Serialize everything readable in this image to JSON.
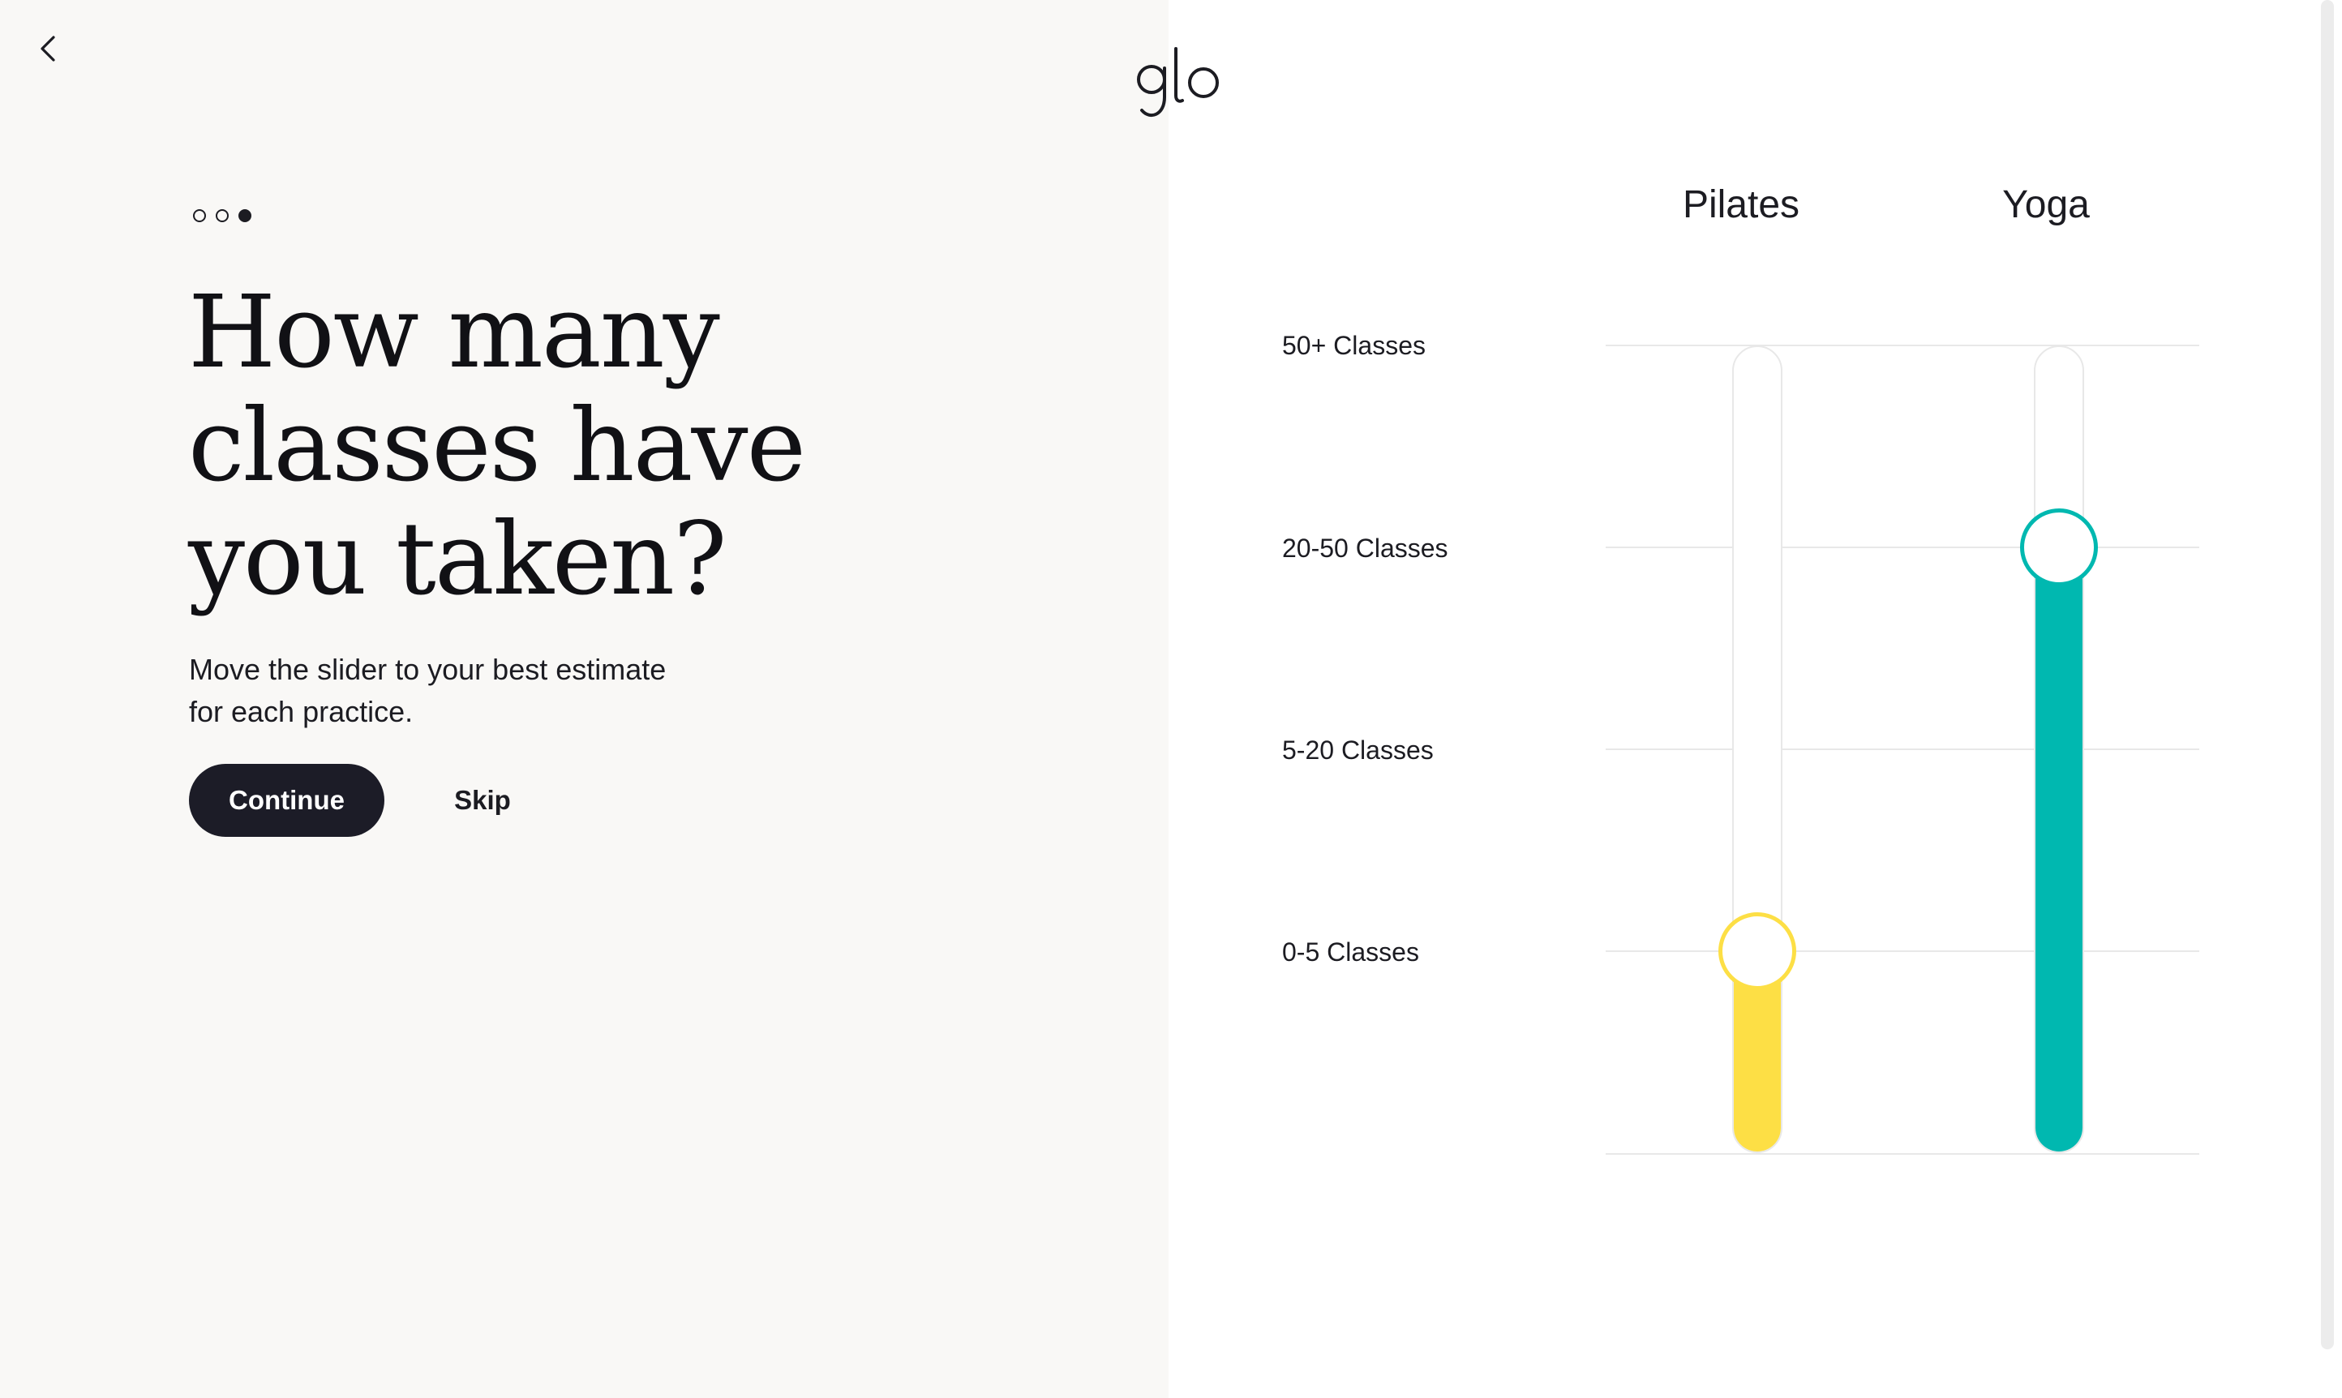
{
  "app": {
    "logo_text": "glo"
  },
  "navigation": {
    "back_icon": "chevron-left-icon"
  },
  "progress": {
    "total_steps": 3,
    "current_step": 3
  },
  "question": {
    "title_lines": [
      "How many",
      "classes have",
      "you taken?"
    ],
    "subtitle_lines": [
      "Move the slider to your best estimate",
      "for each practice."
    ]
  },
  "actions": {
    "continue_label": "Continue",
    "skip_label": "Skip"
  },
  "scale": {
    "levels": [
      "50+ Classes",
      "20-50 Classes",
      "5-20 Classes",
      "0-5 Classes"
    ]
  },
  "sliders": [
    {
      "practice": "Pilates",
      "selected_level": "0-5 Classes",
      "fill_fraction": 0.25,
      "color": "#fddf45"
    },
    {
      "practice": "Yoga",
      "selected_level": "20-50 Classes",
      "fill_fraction": 0.75,
      "color": "#00b8b0"
    }
  ],
  "colors": {
    "left_background": "#f9f8f6",
    "right_background": "#ffffff",
    "button_dark": "#1c1c27",
    "text": "#1c1c22"
  }
}
